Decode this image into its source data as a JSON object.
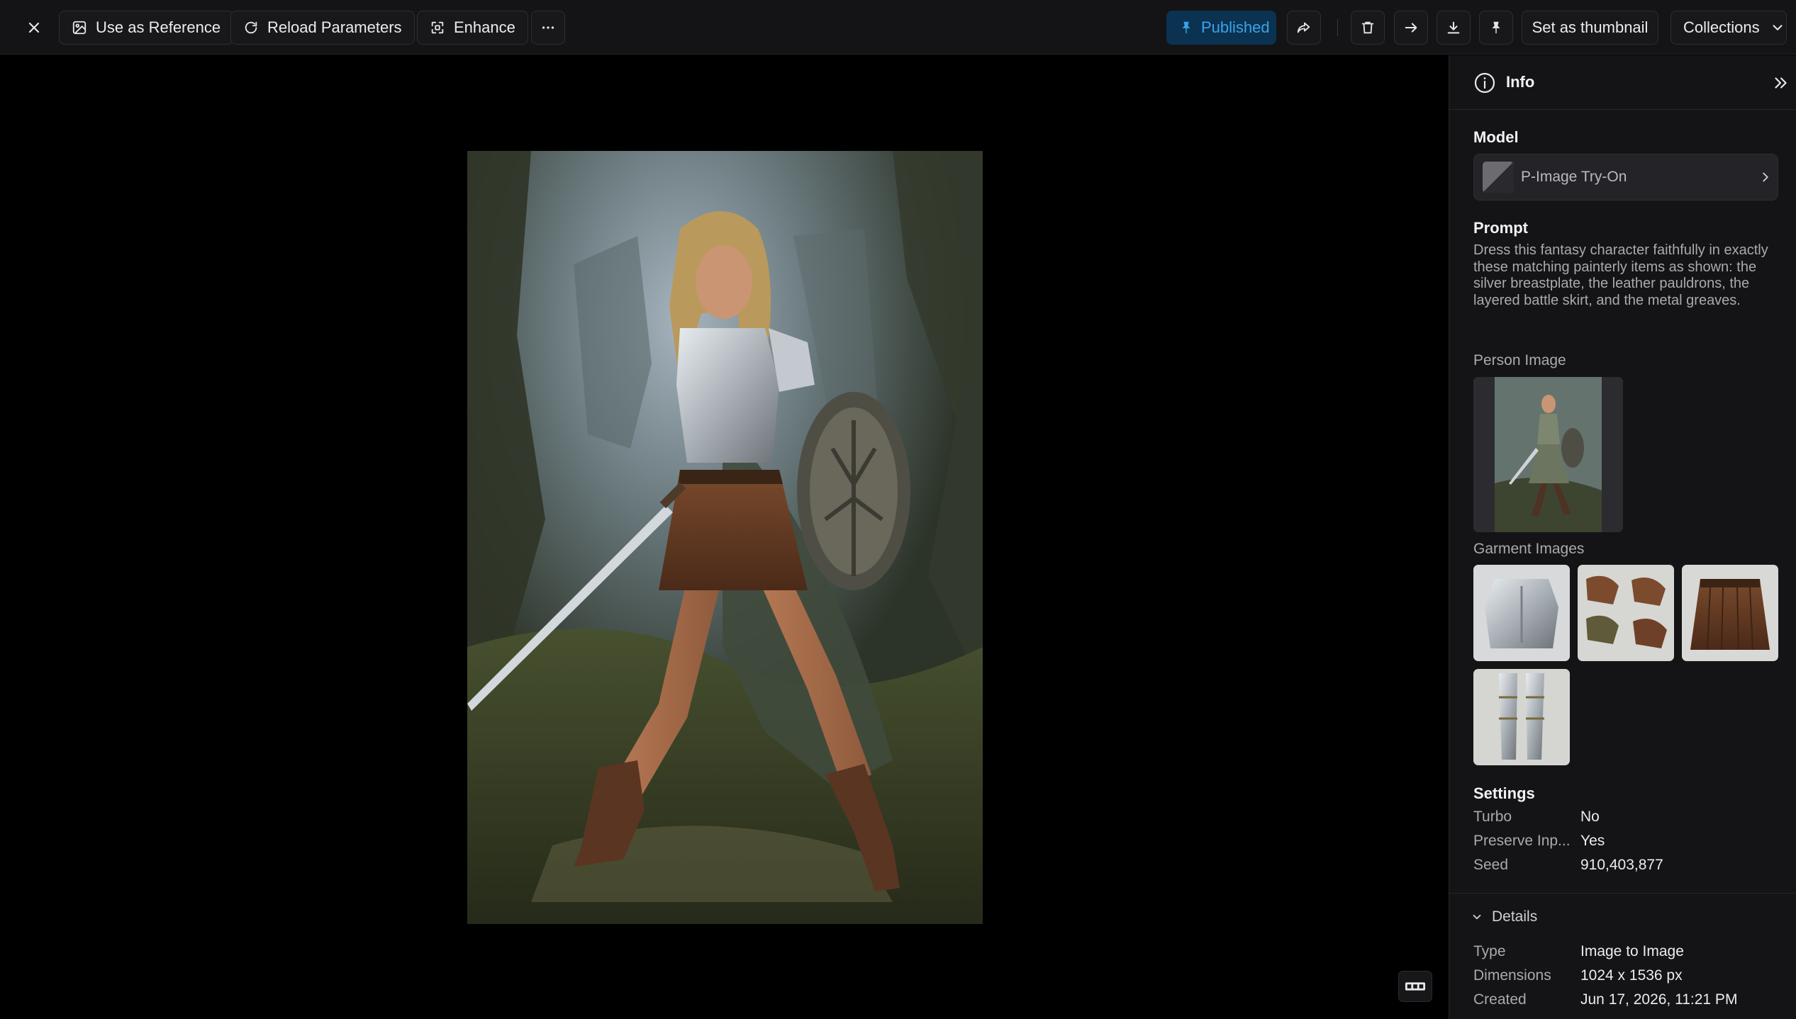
{
  "toolbar": {
    "close_icon": "close-icon",
    "use_as_reference": "Use as Reference",
    "reload_parameters": "Reload Parameters",
    "enhance": "Enhance",
    "more_icon": "more-horizontal-icon",
    "published": "Published",
    "set_as_thumbnail": "Set as thumbnail",
    "collections": "Collections",
    "right_icons": [
      "share-icon",
      "trash-icon",
      "arrow-right-icon",
      "download-icon",
      "pin-icon"
    ]
  },
  "viewer": {
    "image_alt": "Fantasy elf warrior in a silver breastplate, leather pauldrons, layered battle skirt and metal greaves holding a sword and round shield in a misty forest",
    "corner_button_icon": "filmstrip-icon"
  },
  "panel": {
    "title": "Info",
    "model_heading": "Model",
    "model_name": "P-Image Try-On",
    "prompt_heading": "Prompt",
    "prompt_text": "Dress this fantasy character faithfully in exactly these matching painterly items as shown: the silver breastplate, the leather pauldrons, the layered battle skirt, and the metal greaves.",
    "person_image_label": "Person Image",
    "garment_images_label": "Garment Images",
    "garments": [
      "silver breastplate",
      "leather pauldrons",
      "layered battle skirt",
      "metal greaves"
    ],
    "settings_heading": "Settings",
    "settings": [
      {
        "key": "Turbo",
        "value": "No"
      },
      {
        "key": "Preserve Inp...",
        "value": "Yes"
      },
      {
        "key": "Seed",
        "value": "910,403,877"
      }
    ],
    "details_heading": "Details",
    "details": [
      {
        "key": "Type",
        "value": "Image to Image"
      },
      {
        "key": "Dimensions",
        "value": "1024 x 1536 px"
      },
      {
        "key": "Created",
        "value": "Jun 17, 2026, 11:21 PM"
      }
    ]
  },
  "colors": {
    "background": "#000000",
    "panel": "#141416",
    "published_bg": "#0b3250",
    "published_text": "#3ba2ec"
  }
}
